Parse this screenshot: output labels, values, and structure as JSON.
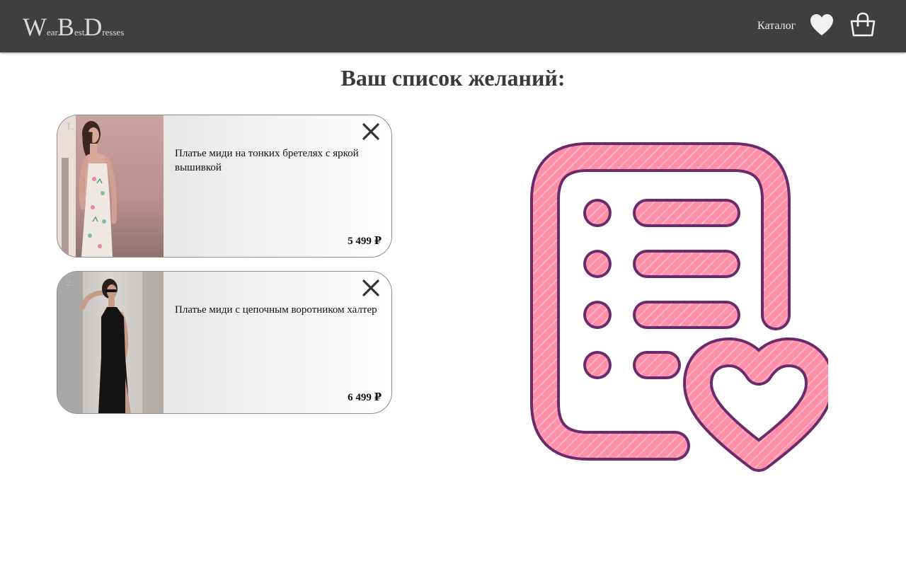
{
  "header": {
    "logo": {
      "parts": [
        {
          "big": "W",
          "small": "ear"
        },
        {
          "big": "B",
          "small": "est"
        },
        {
          "big": "D",
          "small": "resses"
        }
      ]
    },
    "nav": {
      "catalog_label": "Каталог",
      "wishlist_icon": "heart-icon",
      "cart_icon": "shopping-bag-icon"
    }
  },
  "page": {
    "title": "Ваш список желаний:"
  },
  "wishlist": {
    "items": [
      {
        "number": "1.",
        "name": "Платье миди на тонких бретелях с яркой вышивкой",
        "price": "5 499 ₽",
        "remove_icon": "close-icon",
        "photo": "dress-photo-floral"
      },
      {
        "number": "2.",
        "name": "Платье миди с цепочным воротником халтер",
        "price": "6 499 ₽",
        "remove_icon": "close-icon",
        "photo": "dress-photo-black"
      }
    ]
  },
  "illustration": {
    "icon": "wishlist-document-heart-icon"
  },
  "colors": {
    "header_bg": "#3f3f3f",
    "illustration_fill": "#ff8fa8",
    "illustration_outline": "#6a2a6e"
  }
}
